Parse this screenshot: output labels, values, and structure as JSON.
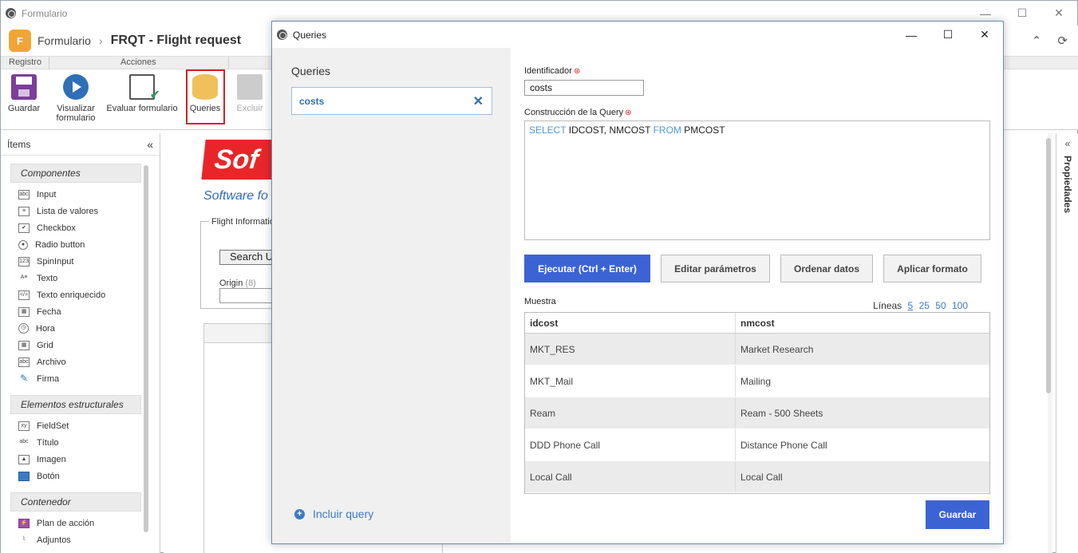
{
  "main_window": {
    "title": "Formulario",
    "breadcrumb_root": "Formulario",
    "breadcrumb_current": "FRQT - Flight request"
  },
  "ribbon": {
    "group_registro": "Registro",
    "group_acciones": "Acciones",
    "buttons": {
      "guardar": "Guardar",
      "visualizar": "Visualizar formulario",
      "evaluar": "Evaluar formulario",
      "queries": "Queries",
      "excluir": "Excluir"
    }
  },
  "left_panel": {
    "title": "Ítems",
    "sections": [
      {
        "title": "Componentes",
        "items": [
          "Input",
          "Lista de valores",
          "Checkbox",
          "Radio button",
          "SpinInput",
          "Texto",
          "Texto enriquecido",
          "Fecha",
          "Hora",
          "Grid",
          "Archivo",
          "Firma"
        ]
      },
      {
        "title": "Elementos estructurales",
        "items": [
          "FieldSet",
          "Título",
          "Imagen",
          "Botón"
        ]
      },
      {
        "title": "Contenedor",
        "items": [
          "Plan de acción",
          "Adjuntos"
        ]
      }
    ]
  },
  "canvas": {
    "logo_text": "Sof",
    "subtitle": "Software fo",
    "fieldset_legend": "Flight Informatio",
    "search_button": "Search U",
    "origin_label": "Origin",
    "origin_count": "(8)"
  },
  "right_panel": {
    "label": "Propiedades"
  },
  "dialog": {
    "title": "Queries",
    "list_title": "Queries",
    "queries": [
      {
        "name": "costs"
      }
    ],
    "add_query": "Incluir query",
    "identifier_label": "Identificador",
    "identifier_value": "costs",
    "query_label": "Construcción de la Query",
    "sql": {
      "select_kw": "SELECT",
      "fields": " IDCOST, NMCOST ",
      "from_kw": "FROM",
      "table": " PMCOST"
    },
    "buttons": {
      "execute": "Ejecutar (Ctrl + Enter)",
      "edit_params": "Editar parámetros",
      "sort": "Ordenar datos",
      "format": "Aplicar formato",
      "save": "Guardar"
    },
    "sample_label": "Muestra",
    "lines_label": "Líneas",
    "lines_options": [
      "5",
      "25",
      "50",
      "100"
    ],
    "lines_active": "5",
    "grid": {
      "columns": [
        "idcost",
        "nmcost"
      ],
      "rows": [
        [
          "MKT_RES",
          "Market Research"
        ],
        [
          "MKT_Mail",
          "Mailing"
        ],
        [
          "Ream",
          "Ream - 500 Sheets"
        ],
        [
          "DDD Phone Call",
          "Distance Phone Call"
        ],
        [
          "Local Call",
          "Local Call"
        ]
      ]
    }
  }
}
